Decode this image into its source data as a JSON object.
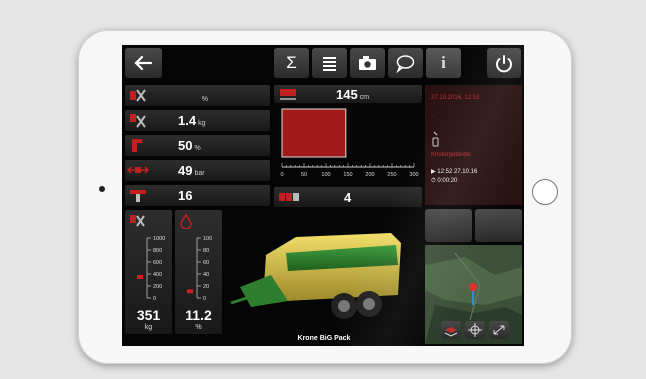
{
  "toolbar": {
    "back_icon": "arrow-left-icon",
    "sum_icon": "sigma-icon",
    "list_icon": "list-icon",
    "camera_icon": "camera-icon",
    "chat_icon": "speech-bubble-icon",
    "info_icon": "info-icon",
    "power_icon": "power-icon",
    "sum_glyph": "Σ",
    "info_glyph": "i"
  },
  "left_rows": [
    {
      "value": "",
      "unit": "%"
    },
    {
      "value": "1.4",
      "unit": "kg"
    },
    {
      "value": "50",
      "unit": "%"
    },
    {
      "value": "49",
      "unit": "bar"
    },
    {
      "value": "16",
      "unit": ""
    }
  ],
  "chart_data": {
    "type": "bar",
    "categories": [
      "bale length"
    ],
    "values": [
      145
    ],
    "xlim": [
      0,
      300
    ],
    "ticks": [
      "0",
      "50",
      "100",
      "150",
      "200",
      "250",
      "300"
    ],
    "value_label": "145",
    "unit": "cm",
    "bar_color": "#a01a1a"
  },
  "bale_count": "4",
  "info_panel": {
    "line1": "27.10.2016, 12:53",
    "line2": "-",
    "alert": "Knotergebinde",
    "time1": "12:52 27.10.16",
    "time2": "0:00:20"
  },
  "gauges": [
    {
      "ticks": [
        "1000",
        "800",
        "600",
        "400",
        "200",
        "0"
      ],
      "value": "351",
      "unit": "kg",
      "level": 0.351
    },
    {
      "ticks": [
        "100",
        "80",
        "60",
        "40",
        "20",
        "0"
      ],
      "value": "11.2",
      "unit": "%",
      "level": 0.112
    }
  ],
  "machine_label": "Krone BiG Pack",
  "map": {
    "buttons": [
      "layers-icon",
      "crosshair-icon",
      "zoom-icon"
    ]
  }
}
